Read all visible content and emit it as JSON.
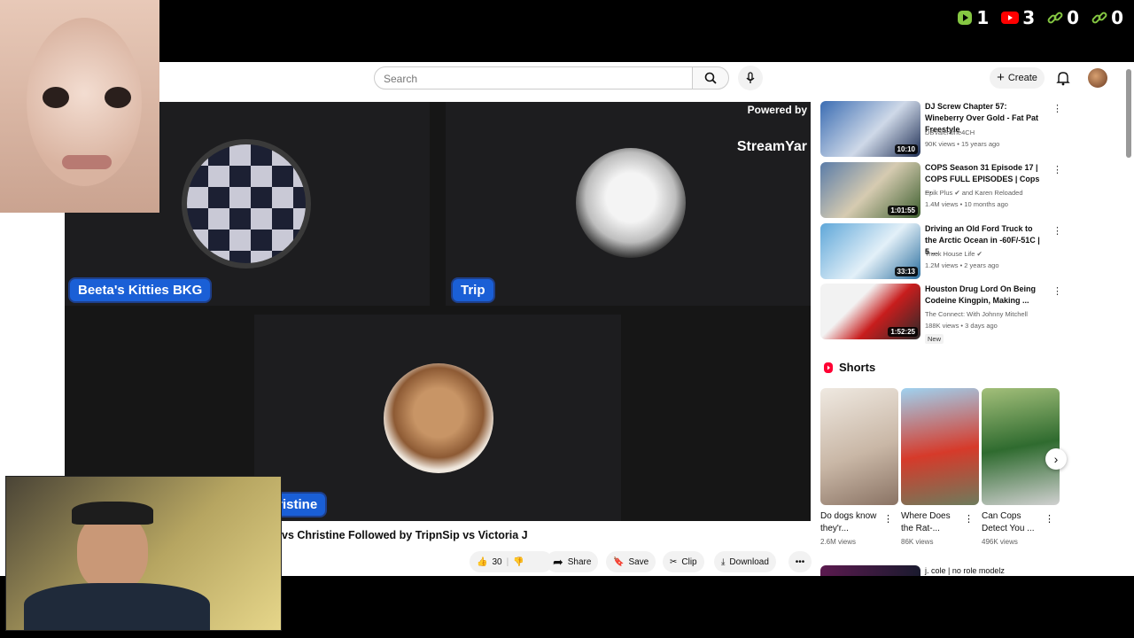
{
  "overlay": {
    "stats": [
      {
        "icon": "rumble-icon",
        "value": "1",
        "color": "#85c742"
      },
      {
        "icon": "youtube-icon",
        "value": "3",
        "color": "#ff0000"
      },
      {
        "icon": "link-icon",
        "value": "0",
        "color": "#85c742"
      },
      {
        "icon": "link-icon",
        "value": "0",
        "color": "#85c742"
      }
    ]
  },
  "header": {
    "search_placeholder": "Search",
    "create_label": "Create"
  },
  "video": {
    "powered_by": "Powered by",
    "brand": "StreamYar",
    "participants": [
      {
        "name": "Beeta's Kitties BKG"
      },
      {
        "name": "Trip"
      },
      {
        "name": "hristine"
      }
    ],
    "title": "vs Christine Followed by TripnSip vs Victoria J",
    "actions": {
      "likes": "30",
      "share": "Share",
      "save": "Save",
      "clip": "Clip",
      "download": "Download"
    }
  },
  "recommendations": [
    {
      "title": "DJ Screw Chapter 57: Wineberry Over Gold - Fat Pat Freestyle",
      "channel": "DBValentine4CH",
      "meta": "90K views • 15 years ago",
      "duration": "10:10",
      "badge": ""
    },
    {
      "title": "COPS Season 31 Episode 17 | COPS FULL EPISODES | Cops ...",
      "channel": "Epik Plus ✔ and Karen Reloaded",
      "meta": "1.4M views • 10 months ago",
      "duration": "1:01:55",
      "badge": ""
    },
    {
      "title": "Driving an Old Ford Truck to the Arctic Ocean in -60F/-51C | 5 ...",
      "channel": "Truck House Life ✔",
      "meta": "1.2M views • 2 years ago",
      "duration": "33:13",
      "badge": ""
    },
    {
      "title": "Houston Drug Lord On Being Codeine Kingpin, Making ...",
      "channel": "The Connect: With Johnny Mitchell",
      "meta": "188K views • 3 days ago",
      "duration": "1:52:25",
      "badge": "New"
    }
  ],
  "shorts": {
    "heading": "Shorts",
    "items": [
      {
        "title": "Do dogs know they'r...",
        "views": "2.6M views"
      },
      {
        "title": "Where Does the Rat-...",
        "views": "86K views"
      },
      {
        "title": "Can Cops Detect You ...",
        "views": "496K views"
      }
    ]
  },
  "next_rec": {
    "title": "j. cole | no role modelz"
  }
}
